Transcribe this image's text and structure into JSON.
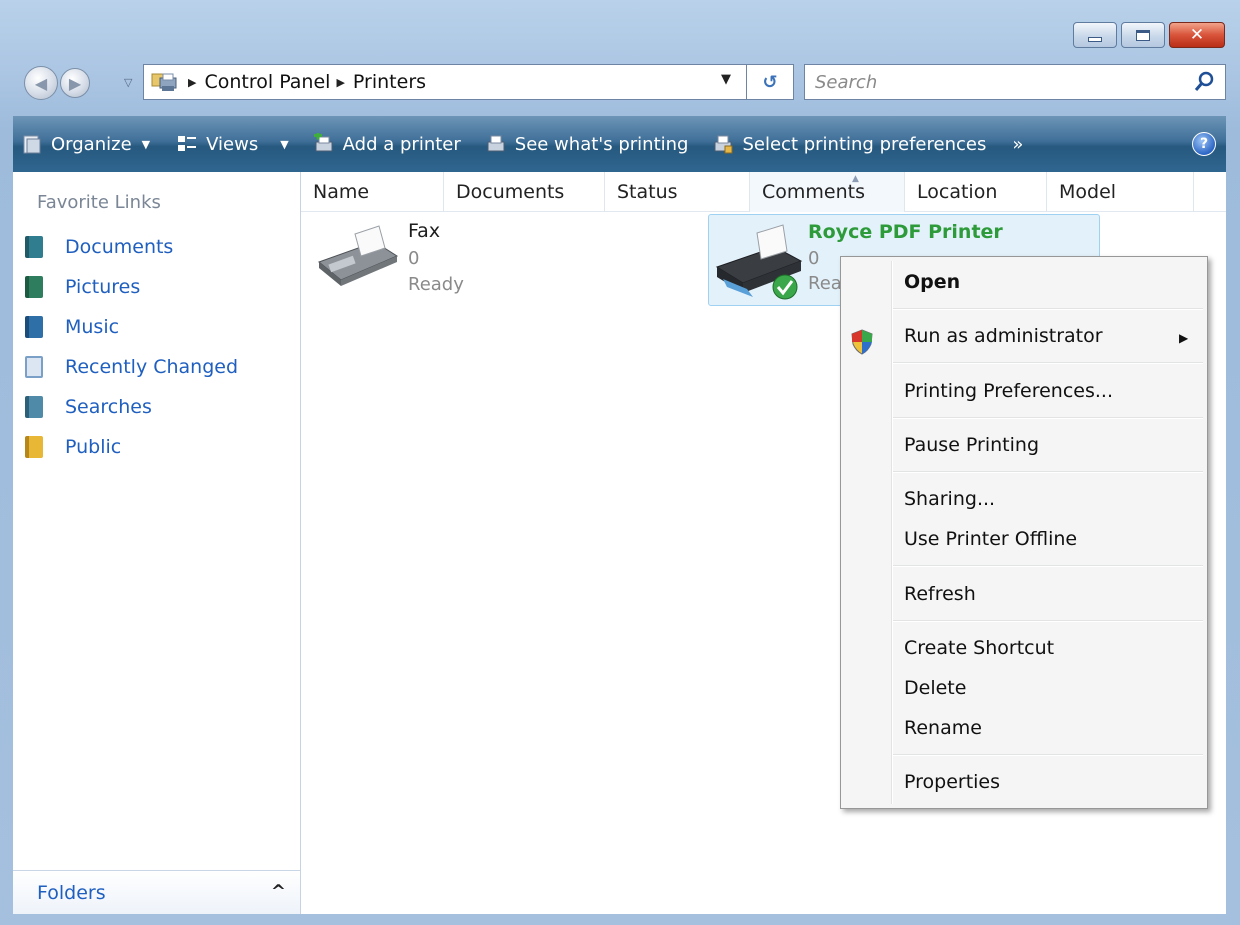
{
  "window": {
    "close_glyph": "✕"
  },
  "address": {
    "crumbs": [
      "Control Panel",
      "Printers"
    ],
    "refresh_glyph": "↺",
    "dropdown_glyph": "▼",
    "search_placeholder": "Search"
  },
  "toolbar": {
    "organize": "Organize",
    "views": "Views",
    "add_printer": "Add a printer",
    "see_printing": "See what's printing",
    "select_prefs": "Select printing preferences",
    "more": "»",
    "help": "?"
  },
  "sidebar": {
    "heading": "Favorite Links",
    "items": [
      {
        "label": "Documents",
        "icon": "documents-icon",
        "color": "#2f7d8f"
      },
      {
        "label": "Pictures",
        "icon": "pictures-icon",
        "color": "#2f7d5f"
      },
      {
        "label": "Music",
        "icon": "music-icon",
        "color": "#2f6fa8"
      },
      {
        "label": "Recently Changed",
        "icon": "recently-changed-icon",
        "color": "#7aa0c8"
      },
      {
        "label": "Searches",
        "icon": "searches-icon",
        "color": "#4f8aa8"
      },
      {
        "label": "Public",
        "icon": "public-folder-icon",
        "color": "#e7b735"
      }
    ],
    "folders_label": "Folders",
    "folders_chevron": "^"
  },
  "columns": [
    "Name",
    "Documents",
    "Status",
    "Comments",
    "Location",
    "Model"
  ],
  "printers": [
    {
      "name": "Fax",
      "documents": "0",
      "status": "Ready"
    },
    {
      "name": "Royce PDF Printer",
      "documents": "0",
      "status": "Rea",
      "selected": true,
      "default": true
    }
  ],
  "context_menu": {
    "items": [
      "Open",
      "Run as administrator",
      "Printing Preferences...",
      "Pause Printing",
      "Sharing...",
      "Use Printer Offline",
      "Refresh",
      "Create Shortcut",
      "Delete",
      "Rename",
      "Properties"
    ],
    "submenu_arrow": "▶"
  },
  "colors": {
    "link_blue": "#1f5fbf",
    "default_printer_green": "#2e9b3a",
    "selection_bg": "#e3f1fb",
    "selection_border": "#9fd1f2"
  }
}
